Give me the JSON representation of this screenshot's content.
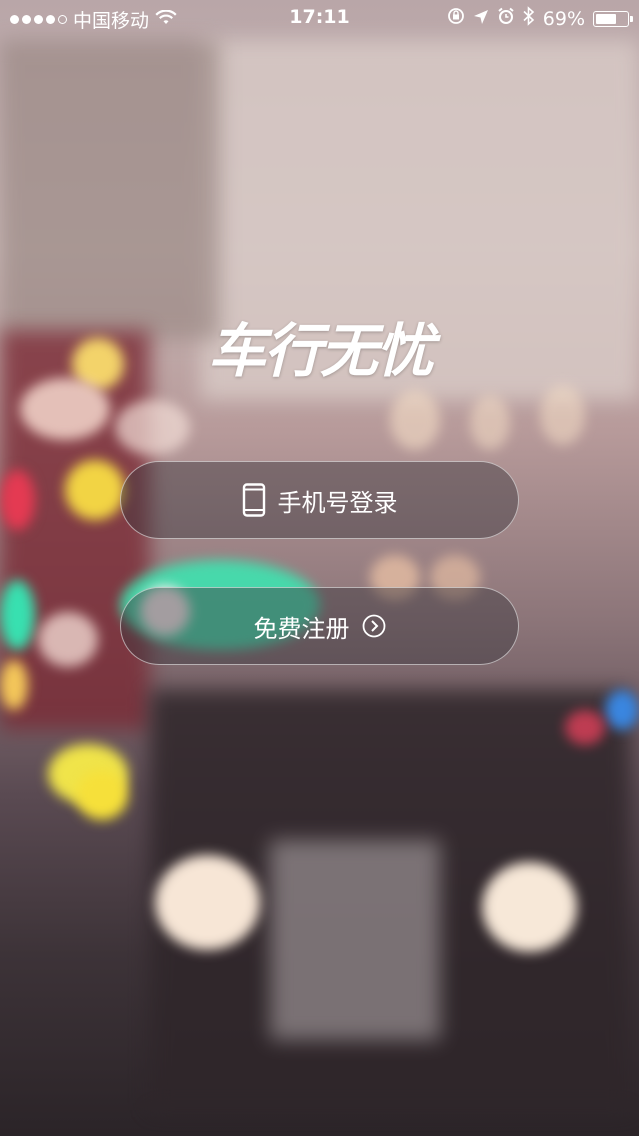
{
  "status_bar": {
    "carrier": "中国移动",
    "time": "17:11",
    "battery_percent_label": "69%",
    "battery_level": 0.69,
    "icons": [
      "wifi-icon",
      "rotation-lock-icon",
      "location-icon",
      "alarm-icon",
      "bluetooth-icon",
      "battery-icon"
    ]
  },
  "logo": {
    "text": "车行无忧"
  },
  "buttons": {
    "login_label": "手机号登录",
    "login_icon": "phone-icon",
    "register_label": "免费注册",
    "register_icon": "chevron-right-circle-icon"
  }
}
